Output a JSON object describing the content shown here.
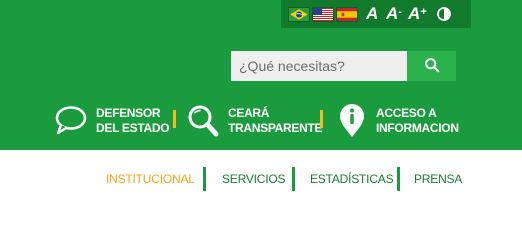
{
  "utility_bar": {
    "flags": [
      {
        "icon": "brazil-flag-icon",
        "language": "Português"
      },
      {
        "icon": "usa-flag-icon",
        "language": "English"
      },
      {
        "icon": "spain-flag-icon",
        "language": "Español"
      }
    ],
    "font_controls": {
      "normal": "A",
      "decrease": "A",
      "decrease_mark": "-",
      "increase": "A",
      "increase_mark": "+",
      "contrast_icon": "contrast-icon"
    }
  },
  "search": {
    "placeholder": "¿Qué necesitas?",
    "button_icon": "search-icon"
  },
  "quick_links": [
    {
      "icon": "speech-bubble-icon",
      "line1": "DEFENSOR",
      "line2": "DEL ESTADO"
    },
    {
      "icon": "magnifier-icon",
      "line1": "CEARÁ",
      "line2": "TRANSPARENTE"
    },
    {
      "icon": "info-pin-icon",
      "line1": "ACCESO A",
      "line2": "INFORMACION"
    }
  ],
  "nav": {
    "items": [
      {
        "label": "INSTITUCIONAL",
        "active": true
      },
      {
        "label": "SERVICIOS",
        "active": false
      },
      {
        "label": "ESTADÍSTICAS",
        "active": false
      },
      {
        "label": "PRENSA",
        "active": false
      }
    ]
  },
  "colors": {
    "primary_green": "#1a9b3e",
    "dark_green": "#117a2c",
    "search_button": "#2bb24c",
    "accent_yellow": "#f2bd1a",
    "active_nav": "#f3a51a",
    "nav_text": "#1a7d33"
  }
}
